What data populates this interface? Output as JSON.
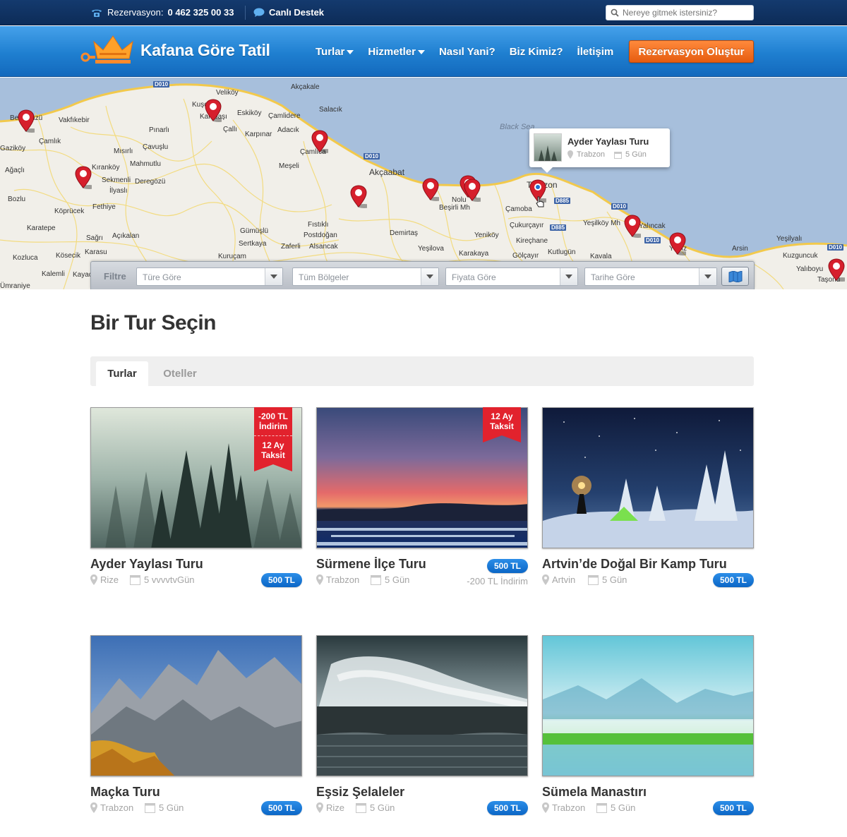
{
  "topbar": {
    "reservation_label": "Rezervasyon:",
    "phone": "0 462 325 00 33",
    "support": "Canlı Destek",
    "search_placeholder": "Nereye gitmek istersiniz?"
  },
  "header": {
    "brand": "Kafana Göre Tatil",
    "nav": [
      "Turlar",
      "Hizmetler",
      "Nasıl Yani?",
      "Biz Kimiz?",
      "İletişim"
    ],
    "cta": "Rezervasyon Oluştur"
  },
  "map": {
    "sea_label": "Black Sea",
    "places": [
      "Beşikdüzü",
      "Vakfıkebir",
      "Çamlık",
      "Pınarlı",
      "Kuşçu",
      "Kalebaşı",
      "Veliköy",
      "Eskiköy",
      "Çamlidere",
      "Salacık",
      "Akçakale",
      "Çallı",
      "Karpınar",
      "Adacık",
      "Çavuşlu",
      "Mısırlı",
      "Mahmutlu",
      "Çamlıca",
      "Akçaabat",
      "Kıranköy",
      "Sekmenli",
      "Deregözü",
      "Meşeli",
      "İlyaslı",
      "Fethiye",
      "Köprücek",
      "Bozlu",
      "Karatepe",
      "Sağrı",
      "Açıkalan",
      "Gümüşlü",
      "Sertkaya",
      "Kozluca",
      "Kösecik",
      "Karasu",
      "Kalemli",
      "Kayacık",
      "Fıstıklı",
      "Postdoğan",
      "Zaferli",
      "Alsancak",
      "Kuruçam",
      "Demirtaş",
      "Yeşilova",
      "Karakaya",
      "Yeniköy",
      "Nolu",
      "Beşirli Mh",
      "Trabzon",
      "Çamoba",
      "Çukurçayır",
      "Kireçhane",
      "Gölçayır",
      "Kutlugün",
      "Yeşilköy Mh",
      "Yalıncak",
      "Yıldız",
      "Kavala",
      "Arsin",
      "Yeşilyalı",
      "Kuzguncuk",
      "Yalıboyu",
      "Taşonu",
      "Ağaçlı",
      "Gaziköy",
      "Ümraniye"
    ],
    "roads": [
      "D010",
      "D010",
      "D010",
      "D885",
      "D885",
      "D010",
      "D010"
    ],
    "popup": {
      "title": "Ayder Yaylası Turu",
      "location": "Trabzon",
      "duration": "5 Gün"
    }
  },
  "filter": {
    "label": "Filtre",
    "selects": [
      "Türe Göre",
      "Tüm Bölgeler",
      "Fiyata Göre",
      "Tarihe Göre"
    ]
  },
  "page": {
    "title": "Bir Tur Seçin",
    "tabs": [
      "Turlar",
      "Oteller"
    ]
  },
  "tours": [
    {
      "name": "Ayder Yaylası Turu",
      "location": "Rize",
      "duration": "5 vvvvtvGün",
      "price": "500 TL",
      "ribbon": [
        "-200 TL İndirim",
        "12 Ay Taksit"
      ]
    },
    {
      "name": "Sürmene İlçe Turu",
      "location": "Trabzon",
      "duration": "5 Gün",
      "price": "500 TL",
      "discount_text": "-200 TL İndirim",
      "ribbon": [
        "12 Ay Taksit"
      ]
    },
    {
      "name": "Artvin’de Doğal Bir Kamp Turu",
      "location": "Artvin",
      "duration": "5 Gün",
      "price": "500 TL"
    },
    {
      "name": "Maçka Turu",
      "location": "Trabzon",
      "duration": "5 Gün",
      "price": "500 TL"
    },
    {
      "name": "Eşsiz Şelaleler",
      "location": "Rize",
      "duration": "5 Gün",
      "price": "500 TL"
    },
    {
      "name": "Sümela Manastırı",
      "location": "Trabzon",
      "duration": "5 Gün",
      "price": "500 TL"
    }
  ],
  "colors": {
    "brand_blue": "#1f7fd0",
    "cta_orange": "#f0701e",
    "price_blue": "#0b66c6",
    "ribbon_red": "#e2222d",
    "pin_red": "#d61f2c"
  }
}
